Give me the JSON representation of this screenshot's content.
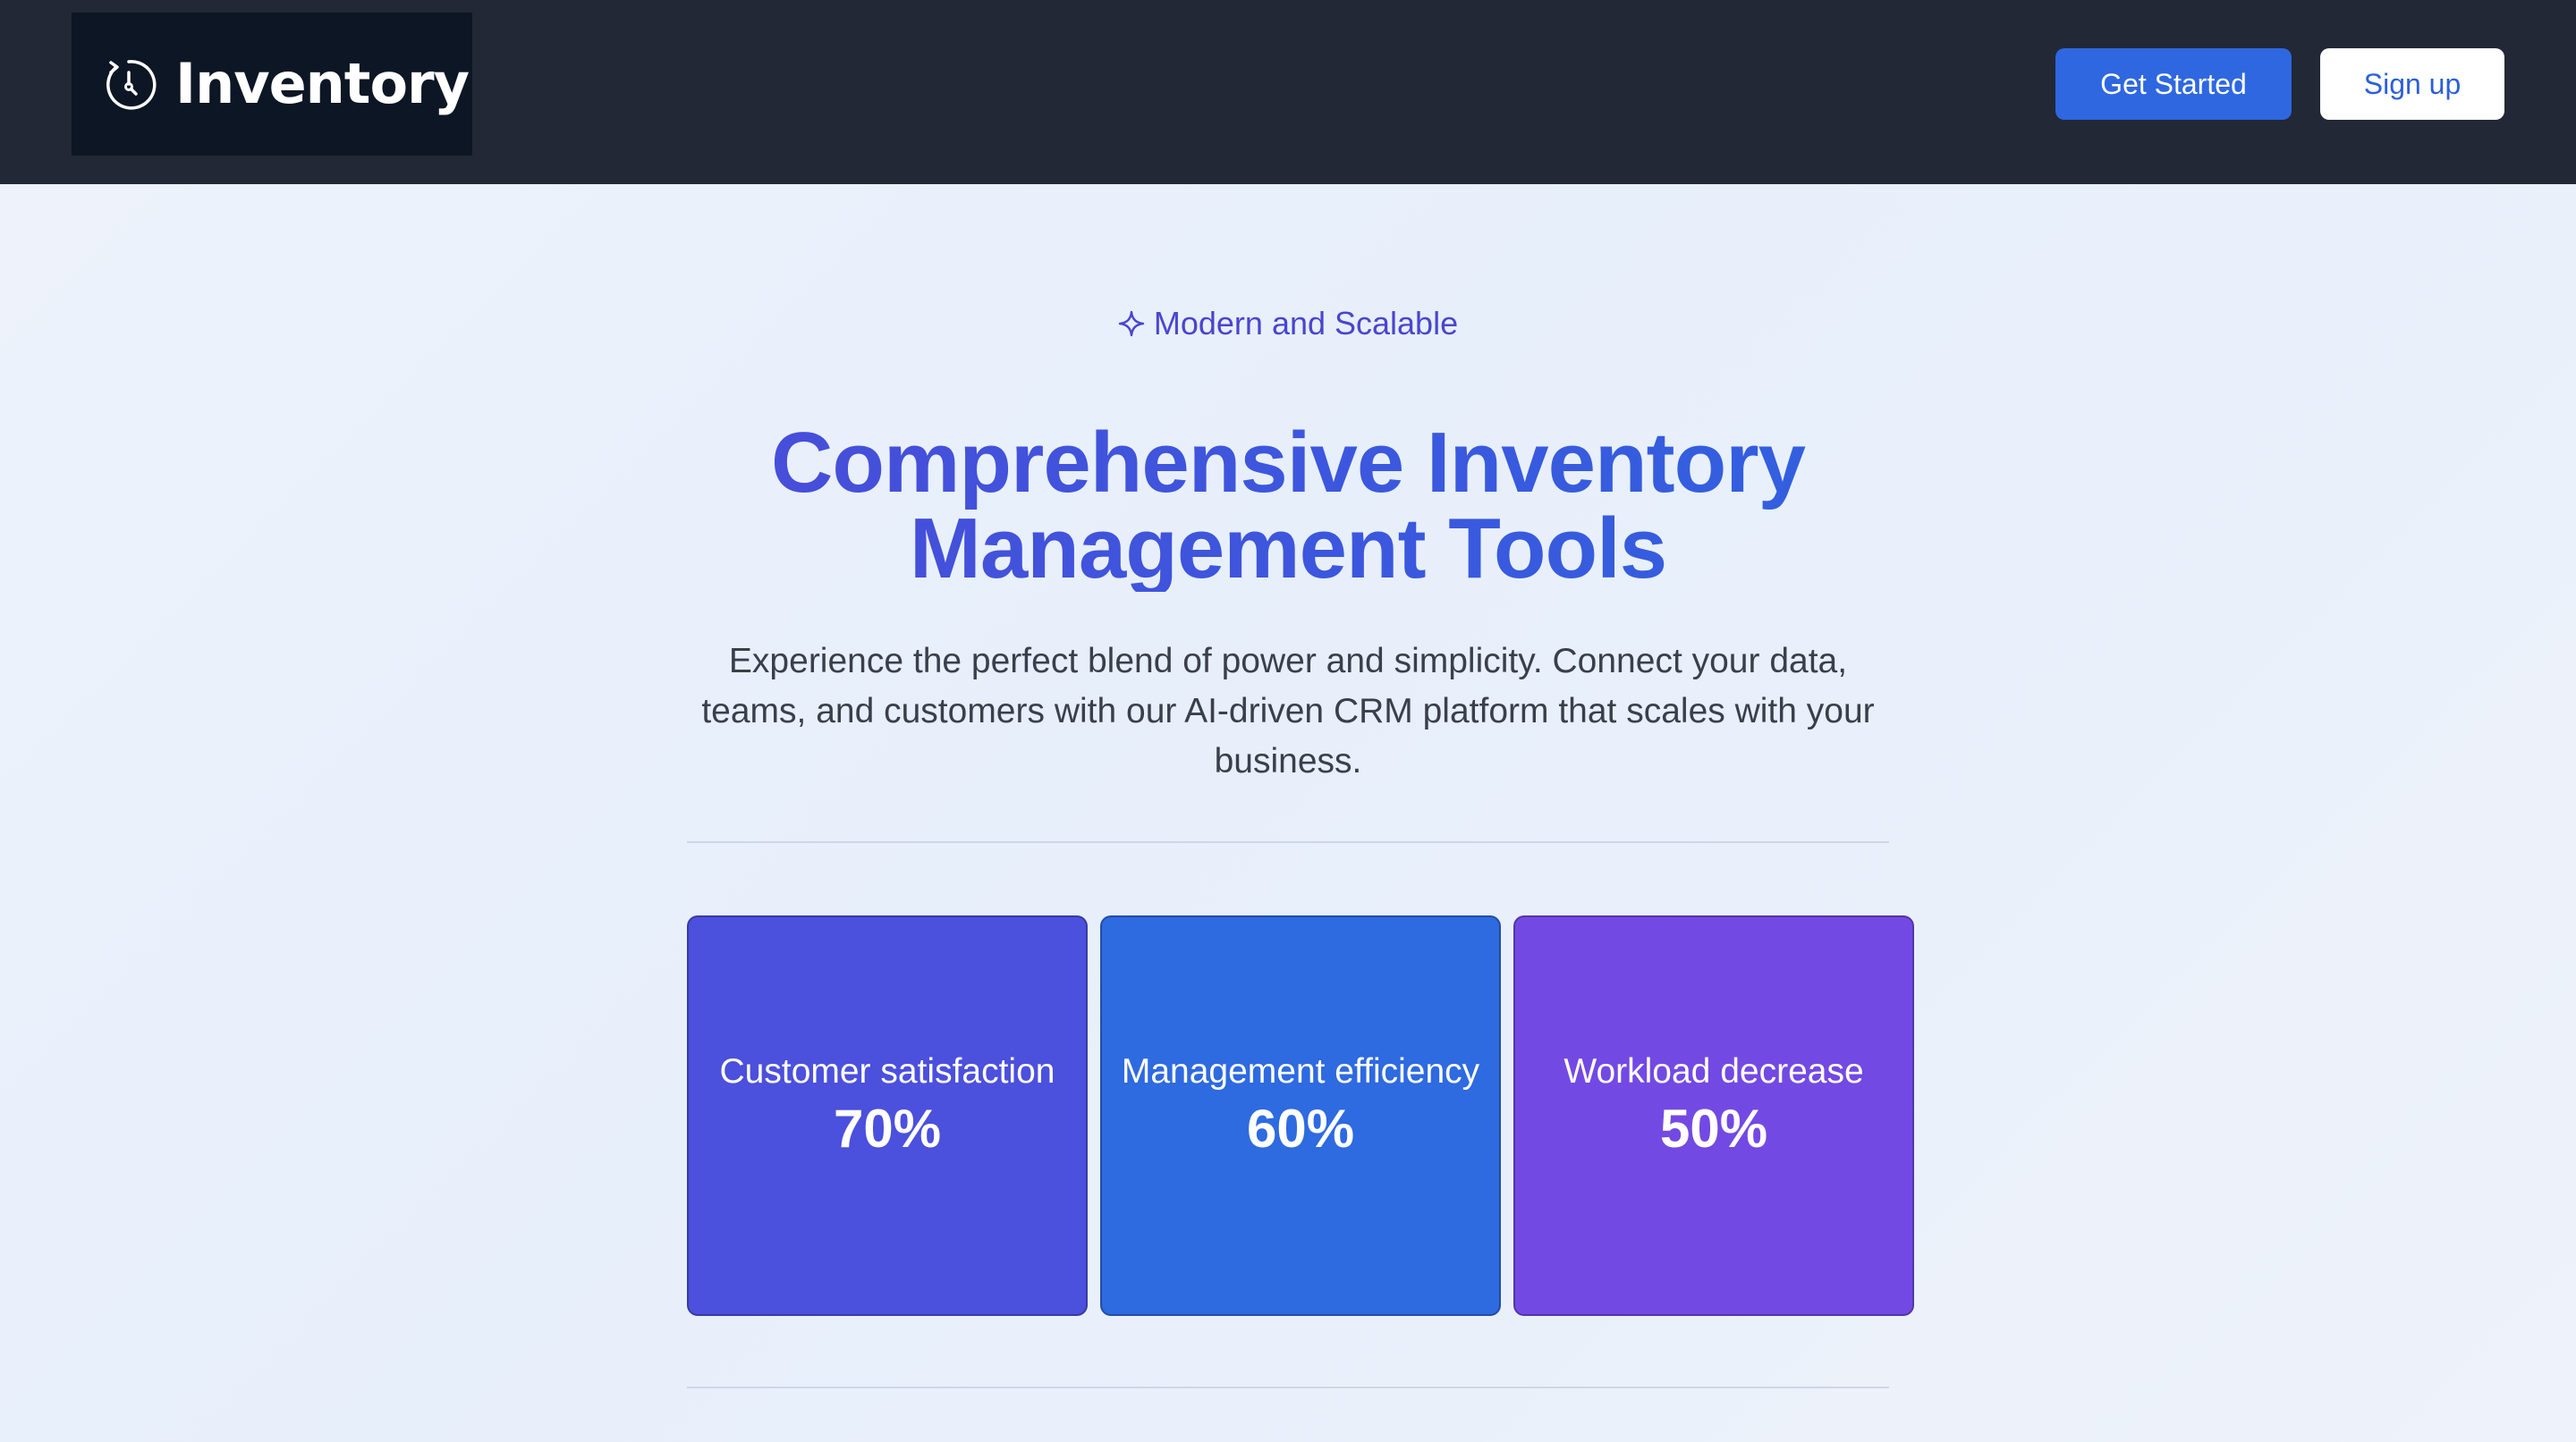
{
  "header": {
    "brand_name": "Inventory",
    "logo_icon": "stopwatch-icon",
    "get_started_label": "Get Started",
    "signup_label": "Sign up"
  },
  "hero": {
    "eyebrow_icon": "sparkle-icon",
    "eyebrow": "Modern and Scalable",
    "title_line1": "Comprehensive Inventory",
    "title_line2": "Management Tools",
    "subtitle": "Experience the perfect blend of power and simplicity. Connect your data, teams, and customers with our AI-driven CRM platform that scales with your business."
  },
  "stats": [
    {
      "label": "Customer satisfaction",
      "value": "70%",
      "color": "#4b50dd"
    },
    {
      "label": "Management efficiency",
      "value": "60%",
      "color": "#2e6ae0"
    },
    {
      "label": "Workload decrease",
      "value": "50%",
      "color": "#7349e3"
    }
  ],
  "colors": {
    "header_bg": "#222836",
    "brand_bg": "#0c1624",
    "primary": "#2e67e0",
    "accent": "#4a45cf"
  }
}
